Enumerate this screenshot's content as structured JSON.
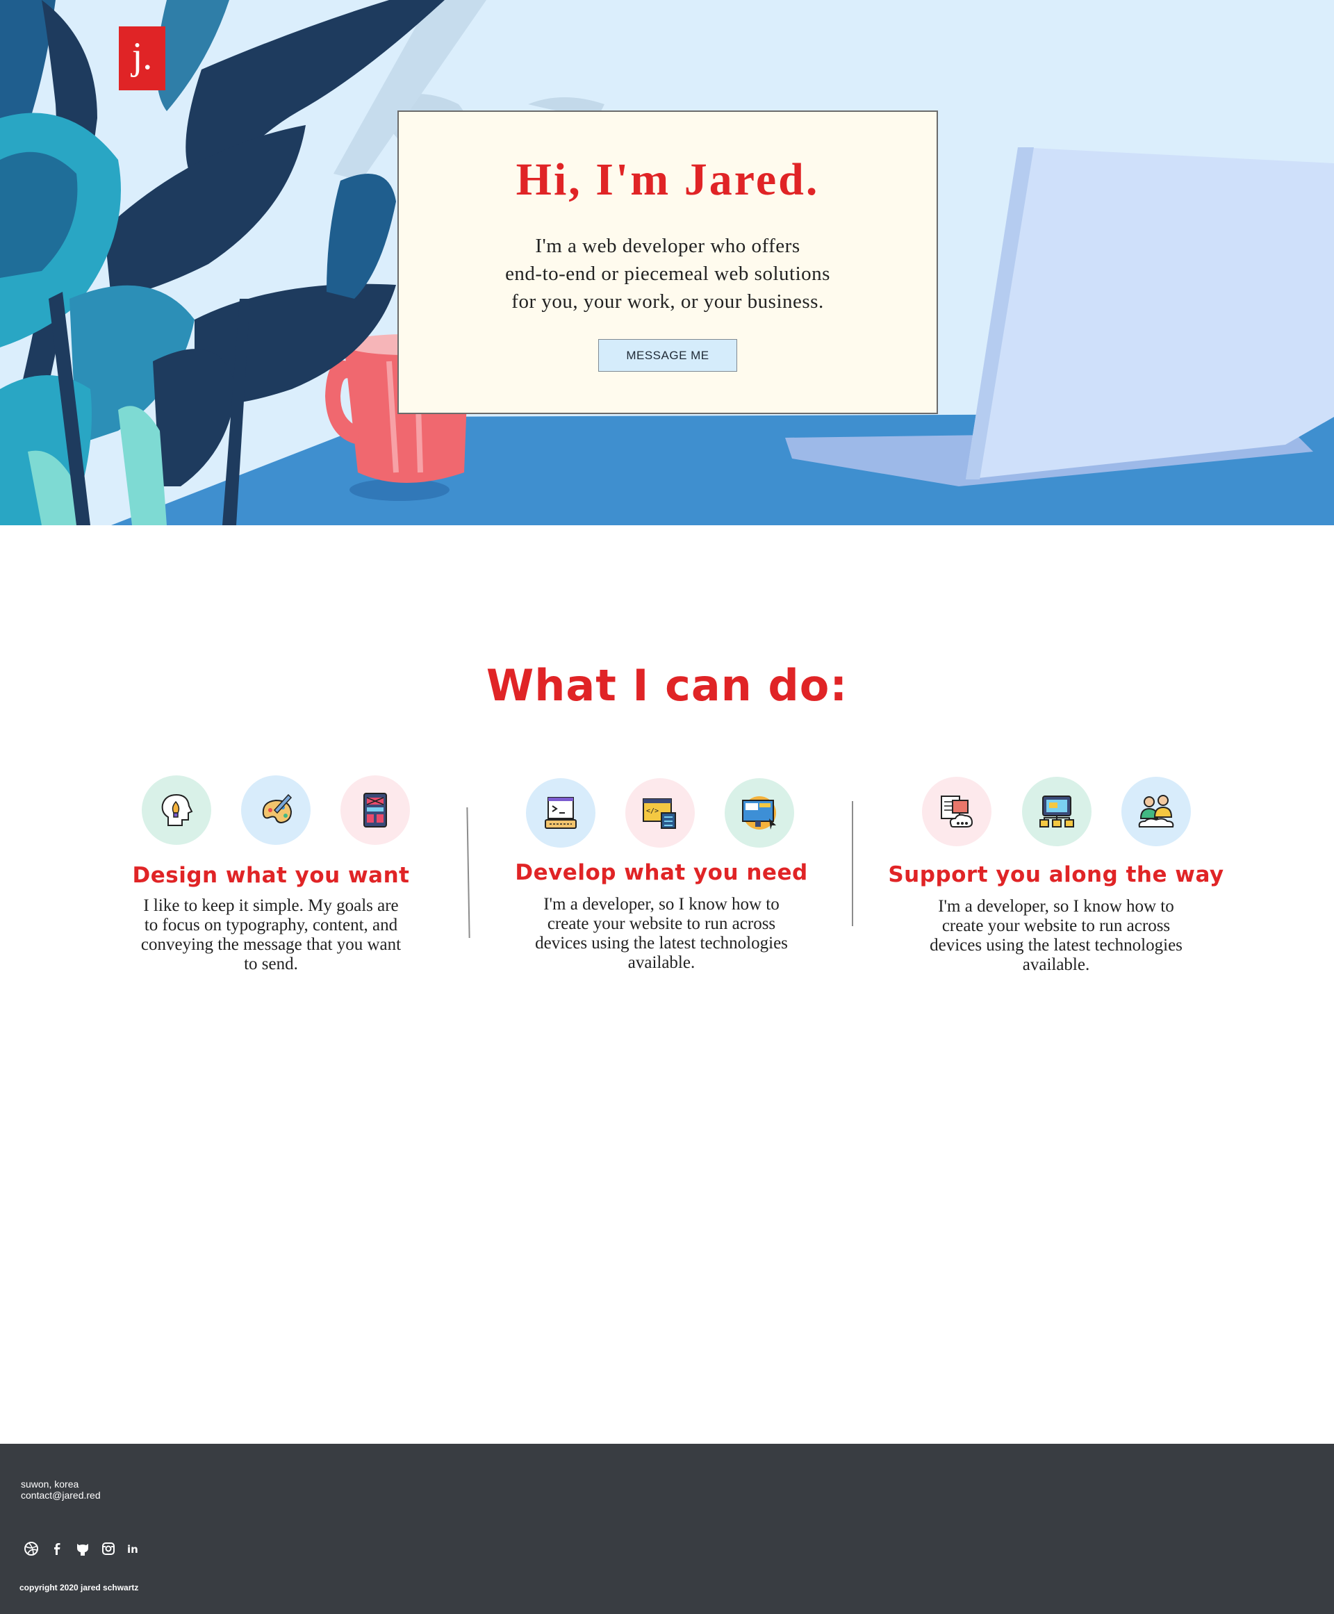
{
  "brand": {
    "logo_letter": "j."
  },
  "hero": {
    "title": "Hi, I'm Jared.",
    "intro_lines": [
      "I'm a web developer who offers",
      "end-to-end or piecemeal web solutions",
      "for you, your work, or your business."
    ],
    "button_label": "MESSAGE ME"
  },
  "services": {
    "title": "What I can do:",
    "columns": [
      {
        "heading": "Design what you want",
        "lines": [
          "I like to keep it simple. My goals are",
          "to focus on typography, content, and",
          "conveying the message that you want",
          "to send."
        ],
        "icons": [
          "idea-head-icon",
          "paint-palette-icon",
          "wireframe-layout-icon"
        ]
      },
      {
        "heading": "Develop what you need",
        "lines": [
          "I'm a developer, so I know how to",
          "create your website to run across",
          "devices using the latest technologies",
          "available."
        ],
        "icons": [
          "code-terminal-icon",
          "browser-code-icon",
          "responsive-screen-icon"
        ]
      },
      {
        "heading": "Support you along the way",
        "lines": [
          "I'm a developer, so I know how to",
          "create your website to run across",
          "devices using the latest technologies",
          "available."
        ],
        "icons": [
          "cloud-documents-icon",
          "network-monitor-icon",
          "team-support-icon"
        ]
      }
    ]
  },
  "footer": {
    "location": "suwon, korea",
    "email": "contact@jared.red",
    "social_icons": [
      "dribbble-icon",
      "facebook-icon",
      "github-icon",
      "instagram-icon",
      "linkedin-icon"
    ],
    "copyright": "copyright 2020 jared schwartz"
  },
  "colors": {
    "accent": "#e02426",
    "hero_sky": "#dbeefc",
    "desk": "#3f8fcf",
    "card_bg": "#fffbee",
    "footer_bg": "#393d42",
    "button_bg": "#d5ecfb"
  }
}
